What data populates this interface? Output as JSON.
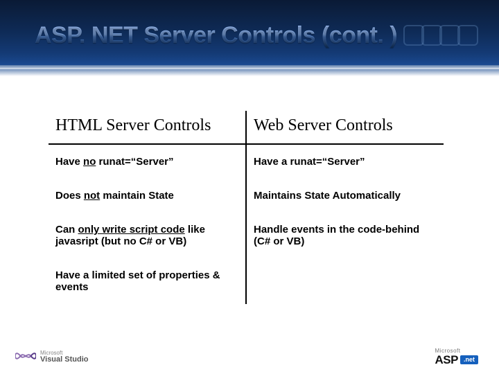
{
  "title": "ASP. NET  Server Controls (cont. )",
  "table": {
    "headers": [
      "HTML Server Controls",
      "Web Server Controls"
    ],
    "rows": [
      {
        "left": {
          "pre": "Have ",
          "u": "no",
          "post": " runat=“Server”"
        },
        "right": "Have a runat=“Server”"
      },
      {
        "left": {
          "pre": "Does ",
          "u": "not",
          "post": " maintain State"
        },
        "right": "Maintains State Automatically"
      },
      {
        "left": {
          "pre": "Can ",
          "u": "only write script code",
          "post": " like javasript (but no C# or VB)"
        },
        "right": "Handle events in the code-behind (C# or VB)"
      },
      {
        "left": {
          "pre": "Have a limited set of properties & events",
          "u": "",
          "post": ""
        },
        "right": ""
      }
    ]
  },
  "footer": {
    "left": {
      "ms": "Microsoft",
      "product": "Visual Studio"
    },
    "right": {
      "ms": "Microsoft",
      "product": "ASP",
      "badge": ".net"
    }
  }
}
